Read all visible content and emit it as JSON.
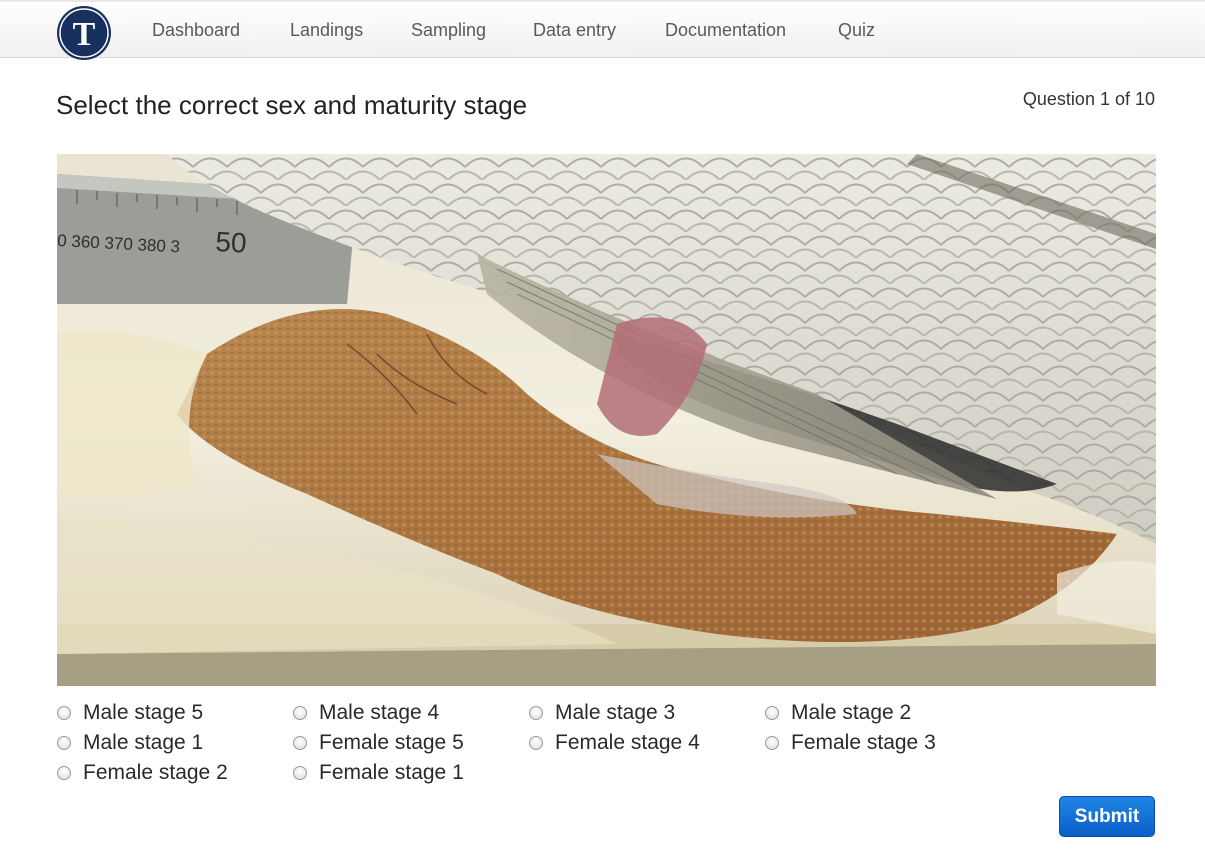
{
  "brand": {
    "logo_letter": "T",
    "logo_color": "#17305e"
  },
  "nav": {
    "items": [
      "Dashboard",
      "Landings",
      "Sampling",
      "Data entry",
      "Documentation",
      "Quiz"
    ]
  },
  "quiz": {
    "title": "Select the correct sex and maturity stage",
    "progress": "Question 1 of 10",
    "options": [
      "Male stage 5",
      "Male stage 4",
      "Male stage 3",
      "Male stage 2",
      "Male stage 1",
      "Female stage 5",
      "Female stage 4",
      "Female stage 3",
      "Female stage 2",
      "Female stage 1"
    ],
    "selected": null,
    "submit_label": "Submit"
  },
  "photo": {
    "ruler_numbers": "0 360 370 380 3",
    "ruler_big": "50"
  },
  "colors": {
    "accent": "#0b6fd8",
    "nav_text": "#5a5a5a"
  }
}
